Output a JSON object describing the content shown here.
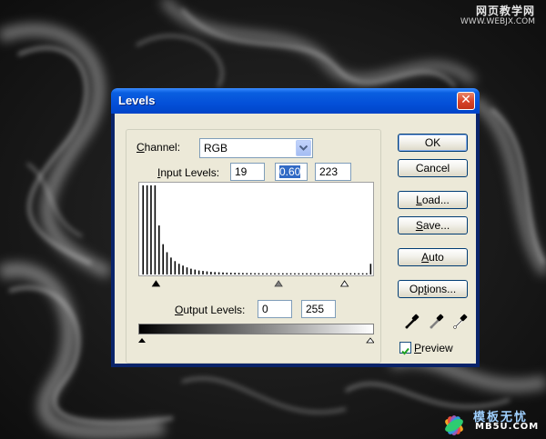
{
  "watermark_top": {
    "line1": "网页教学网",
    "line2": "WWW.WEBJX.COM"
  },
  "watermark_bottom": {
    "line1": "模板无忧",
    "line2": "MB5U.COM"
  },
  "dialog": {
    "title": "Levels",
    "channel": {
      "label_prefix": "",
      "label_u": "C",
      "label_rest": "hannel:",
      "value": "RGB"
    },
    "input_levels": {
      "label_u": "I",
      "label_rest": "nput Levels:",
      "black": "19",
      "gamma": "0.60",
      "white": "223"
    },
    "output_levels": {
      "label_u": "O",
      "label_rest": "utput Levels:",
      "black": "0",
      "white": "255"
    },
    "buttons": {
      "ok": "OK",
      "cancel": "Cancel",
      "load": {
        "u": "L",
        "rest": "oad..."
      },
      "save": {
        "u": "S",
        "rest": "ave..."
      },
      "auto": {
        "u": "A",
        "rest": "uto"
      },
      "options": {
        "u": "",
        "pre": "Op",
        "u2": "t",
        "rest": "ions..."
      }
    },
    "preview": {
      "u": "P",
      "rest": "review",
      "checked": true
    },
    "histogram_levels": [
      1.0,
      1.0,
      1.0,
      1.0,
      0.55,
      0.34,
      0.25,
      0.19,
      0.15,
      0.12,
      0.1,
      0.08,
      0.065,
      0.055,
      0.045,
      0.04,
      0.035,
      0.03,
      0.027,
      0.025,
      0.023,
      0.021,
      0.02,
      0.019,
      0.018,
      0.017,
      0.016,
      0.016,
      0.015,
      0.015,
      0.014,
      0.014,
      0.014,
      0.014,
      0.014,
      0.014,
      0.014,
      0.014,
      0.014,
      0.014,
      0.014,
      0.014,
      0.014,
      0.014,
      0.014,
      0.014,
      0.014,
      0.014,
      0.014,
      0.014,
      0.014,
      0.014,
      0.014,
      0.014,
      0.014,
      0.014,
      0.014,
      0.12
    ],
    "slider_positions": {
      "black": 0.075,
      "gamma": 0.595,
      "white": 0.875
    }
  }
}
